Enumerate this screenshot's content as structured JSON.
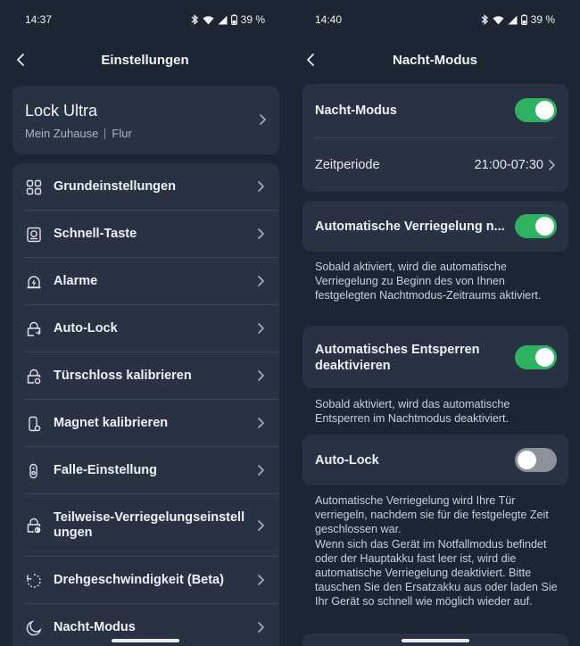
{
  "left": {
    "status": {
      "time": "14:37",
      "battery": "39 %"
    },
    "header": {
      "title": "Einstellungen"
    },
    "device": {
      "name": "Lock Ultra",
      "home": "Mein Zuhause",
      "room": "Flur"
    },
    "menu": [
      {
        "label": "Grundeinstellungen",
        "icon": "grid-icon"
      },
      {
        "label": "Schnell-Taste",
        "icon": "quick-button-icon"
      },
      {
        "label": "Alarme",
        "icon": "bell-icon"
      },
      {
        "label": "Auto-Lock",
        "icon": "auto-lock-icon"
      },
      {
        "label": "Türschloss kalibrieren",
        "icon": "lock-calibrate-icon"
      },
      {
        "label": "Magnet kalibrieren",
        "icon": "magnet-icon"
      },
      {
        "label": "Falle-Einstellung",
        "icon": "latch-icon"
      },
      {
        "label": "Teilweise-Verriegelungseinstellungen",
        "icon": "partial-lock-icon"
      },
      {
        "label": "Drehgeschwindigkeit (Beta)",
        "icon": "rotation-speed-icon"
      },
      {
        "label": "Nacht-Modus",
        "icon": "moon-icon"
      }
    ]
  },
  "right": {
    "status": {
      "time": "14:40",
      "battery": "39 %"
    },
    "header": {
      "title": "Nacht-Modus"
    },
    "night_mode": {
      "label": "Nacht-Modus",
      "enabled": true
    },
    "period": {
      "label": "Zeitperiode",
      "value": "21:00-07:30"
    },
    "auto_lock_night": {
      "label": "Automatische Verriegelung n...",
      "enabled": true,
      "description": "Sobald aktiviert, wird die automatische Verriegelung zu Beginn des von Ihnen festgelegten Nachtmodus-Zeitraums aktiviert."
    },
    "auto_unlock": {
      "label": "Automatisches Entsperren deaktivieren",
      "enabled": true,
      "description": "Sobald aktiviert, wird das automatische Entsperren im Nachtmodus deaktiviert."
    },
    "auto_lock": {
      "label": "Auto-Lock",
      "enabled": false,
      "description": "Automatische Verriegelung wird Ihre Tür verriegeln, nachdem sie für die festgelegte Zeit geschlossen war.\nWenn sich das Gerät im Notfallmodus befindet oder der Hauptakku fast leer ist, wird die automatische Verriegelung deaktiviert. Bitte tauschen Sie den Ersatzakku aus oder laden Sie Ihr Gerät so schnell wie möglich wieder auf."
    }
  }
}
